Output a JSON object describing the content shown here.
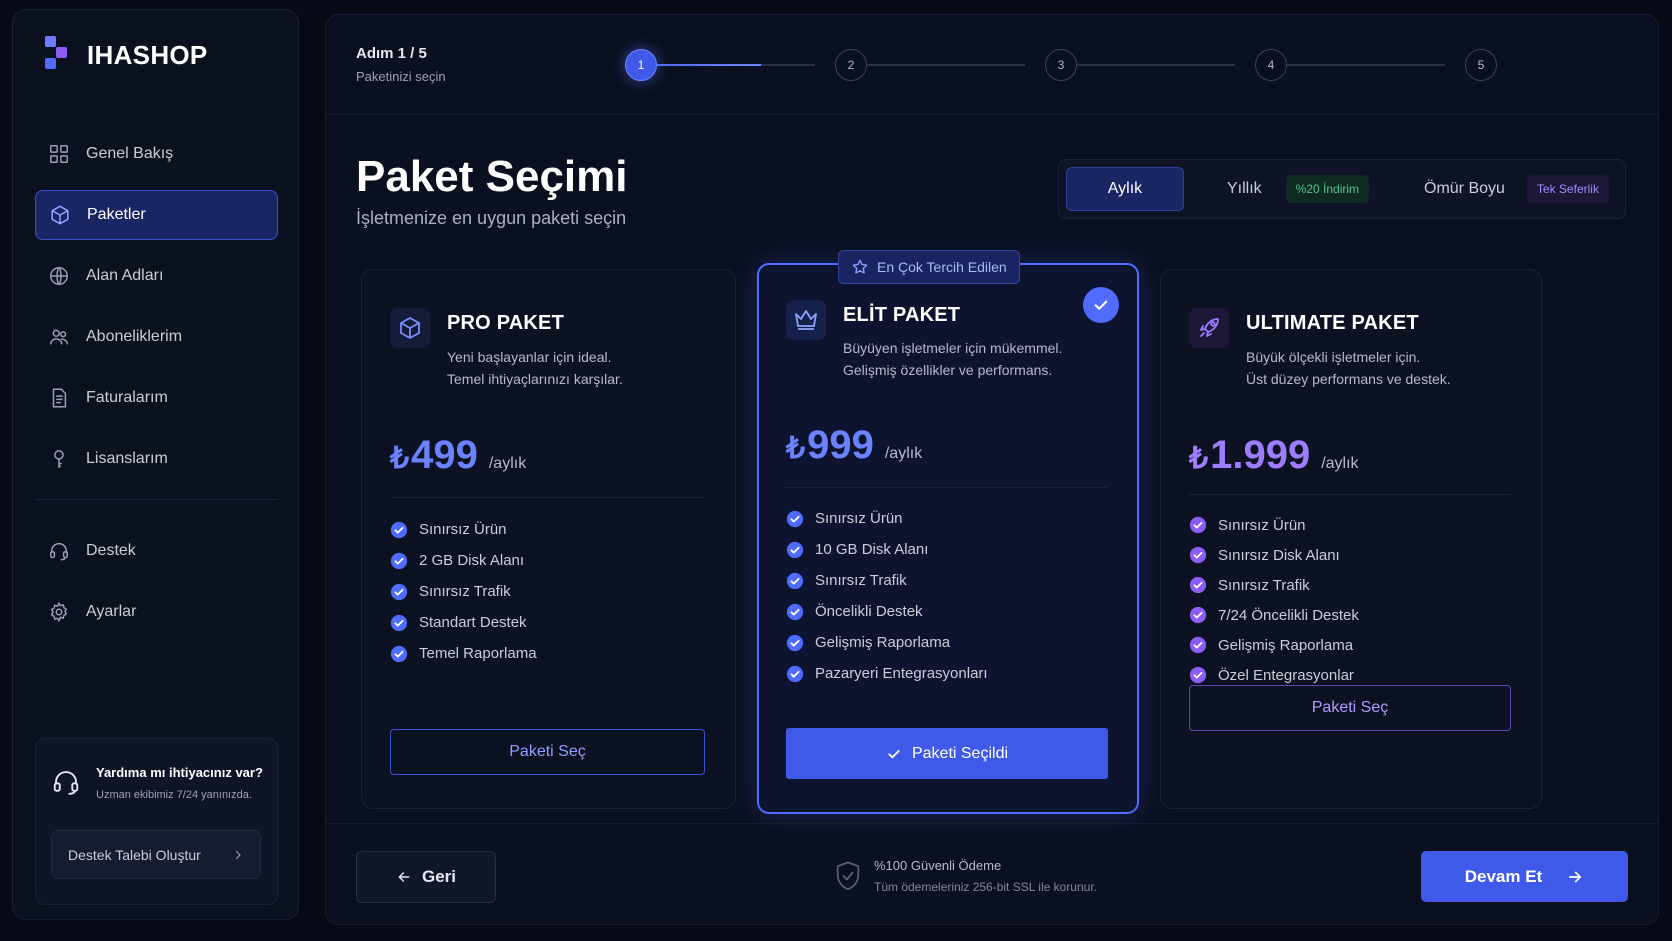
{
  "brand": {
    "name": "IHASHOP"
  },
  "sidebar": {
    "items": [
      {
        "label": "Genel Bakış",
        "icon": "dashboard-icon"
      },
      {
        "label": "Paketler",
        "icon": "package-icon",
        "active": true
      },
      {
        "label": "Alan Adları",
        "icon": "globe-icon"
      },
      {
        "label": "Aboneliklerim",
        "icon": "users-icon"
      },
      {
        "label": "Faturalarım",
        "icon": "invoice-icon"
      },
      {
        "label": "Lisanslarım",
        "icon": "key-icon"
      }
    ],
    "bottom_items": [
      {
        "label": "Destek",
        "icon": "headset-icon"
      },
      {
        "label": "Ayarlar",
        "icon": "gear-icon"
      }
    ],
    "help": {
      "title": "Yardıma mı ihtiyacınız var?",
      "subtitle": "Uzman ekibimiz 7/24 yanınızda.",
      "button": "Destek Talebi Oluştur"
    }
  },
  "steps": {
    "label": "Adım 1 / 5",
    "description": "Paketinizi seçin",
    "items": [
      "1",
      "2",
      "3",
      "4",
      "5"
    ],
    "current": 1,
    "progress_first_segment": 0.66
  },
  "main": {
    "title": "Paket Seçimi",
    "subtitle": "İşletmenize en uygun paketi seçin"
  },
  "billing": {
    "options": [
      "Aylık",
      "Yıllık",
      "Ömür Boyu"
    ],
    "selected": "Aylık",
    "yearly_badge": "%20 İndirim",
    "lifetime_badge": "Tek Seferlik"
  },
  "packages": [
    {
      "name": "PRO PAKET",
      "desc1": "Yeni başlayanlar için ideal.",
      "desc2": "Temel ihtiyaçlarınızı karşılar.",
      "currency": "₺",
      "price": "499",
      "period": "/aylık",
      "features": [
        "Sınırsız Ürün",
        "2 GB Disk Alanı",
        "Sınırsız Trafik",
        "Standart Destek",
        "Temel Raporlama"
      ],
      "button": "Paketi Seç",
      "icon": "box-icon",
      "accent": "#5b74ff"
    },
    {
      "name": "ELİT PAKET",
      "desc1": "Büyüyen işletmeler için mükemmel.",
      "desc2": "Gelişmiş özellikler ve performans.",
      "currency": "₺",
      "price": "999",
      "period": "/aylık",
      "features": [
        "Sınırsız Ürün",
        "10 GB Disk Alanı",
        "Sınırsız Trafik",
        "Öncelikli Destek",
        "Gelişmiş Raporlama",
        "Pazaryeri Entegrasyonları"
      ],
      "button": "Paketi Seçildi",
      "badge": "En Çok Tercih Edilen",
      "selected": true,
      "icon": "crown-icon",
      "accent": "#5b74ff"
    },
    {
      "name": "ULTIMATE PAKET",
      "desc1": "Büyük ölçekli işletmeler için.",
      "desc2": "Üst düzey performans ve destek.",
      "currency": "₺",
      "price": "1.999",
      "period": "/aylık",
      "features": [
        "Sınırsız Ürün",
        "Sınırsız Disk Alanı",
        "Sınırsız Trafik",
        "7/24 Öncelikli Destek",
        "Gelişmiş Raporlama",
        "Özel Entegrasyonlar"
      ],
      "button": "Paketi Seç",
      "icon": "rocket-icon",
      "accent": "#8b5cf6"
    }
  ],
  "footer": {
    "back": "Geri",
    "secure_title": "%100 Güvenli Ödeme",
    "secure_sub": "Tüm ödemeleriniz 256-bit SSL ile korunur.",
    "next": "Devam Et"
  },
  "colors": {
    "primary": "#3f5ae8",
    "accent_purple": "#8b5cf6",
    "background": "#070a14",
    "success": "#52c98b"
  }
}
